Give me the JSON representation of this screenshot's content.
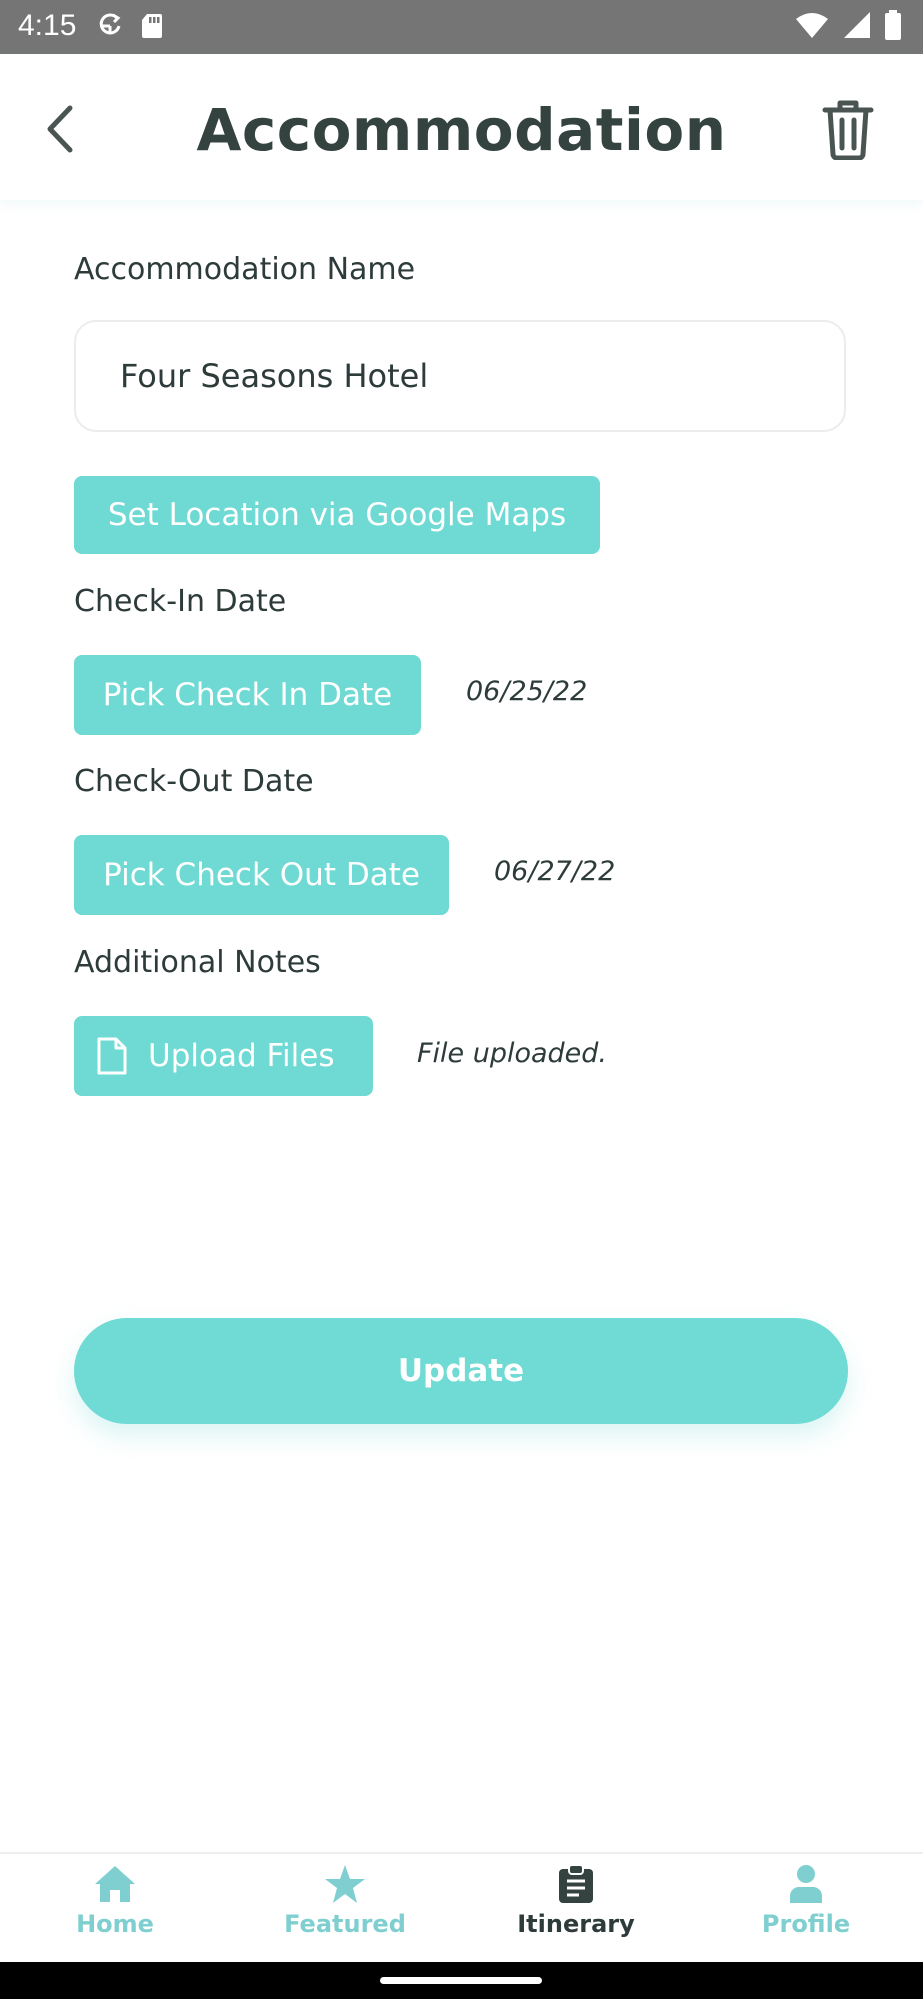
{
  "status_bar": {
    "time": "4:15",
    "icons": [
      "sync-icon",
      "sd-card-icon",
      "wifi-icon",
      "signal-icon",
      "battery-icon"
    ]
  },
  "header": {
    "title": "Accommodation",
    "back_icon": "chevron-left-icon",
    "delete_icon": "trash-icon"
  },
  "form": {
    "name_label": "Accommodation Name",
    "name_value": "Four Seasons Hotel",
    "location_button": "Set Location via Google Maps",
    "checkin_label": "Check-In Date",
    "checkin_button": "Pick Check In Date",
    "checkin_value": "06/25/22",
    "checkout_label": "Check-Out Date",
    "checkout_button": "Pick Check Out Date",
    "checkout_value": "06/27/22",
    "notes_label": "Additional Notes",
    "upload_button": "Upload Files",
    "upload_status": "File uploaded.",
    "update_button": "Update"
  },
  "bottom_nav": {
    "items": [
      {
        "label": "Home",
        "icon": "home-icon",
        "active": false
      },
      {
        "label": "Featured",
        "icon": "star-icon",
        "active": false
      },
      {
        "label": "Itinerary",
        "icon": "clipboard-icon",
        "active": true
      },
      {
        "label": "Profile",
        "icon": "person-icon",
        "active": false
      }
    ]
  },
  "colors": {
    "accent": "#6fd9d4",
    "title": "#34433f",
    "inactive_nav": "#7fcfd0",
    "status_bar": "#757575"
  }
}
